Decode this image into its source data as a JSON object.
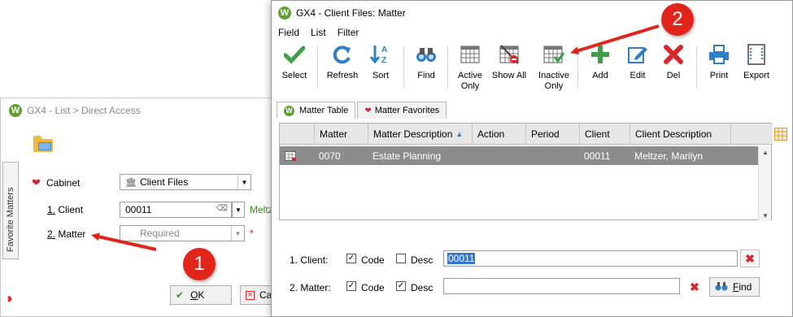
{
  "back_window": {
    "title": "GX4 - List > Direct Access",
    "vertical_tab": "Favorite Matters",
    "cabinet_label": "Cabinet",
    "cabinet_value": "Client Files",
    "client_label_num": "1.",
    "client_label": " Client",
    "client_value": "00011",
    "client_name_partial": "Meltz",
    "matter_label_num": "2.",
    "matter_label": " Matter",
    "matter_placeholder": "Required",
    "required_mark": "*",
    "ok_label_u": "O",
    "ok_label_rest": "K",
    "cancel_partial": "Ca"
  },
  "front_window": {
    "title": "GX4 - Client Files: Matter",
    "menu": [
      "Field",
      "List",
      "Filter"
    ],
    "toolbar": {
      "select": "Select",
      "refresh": "Refresh",
      "sort": "Sort",
      "find": "Find",
      "active_only": [
        "Active",
        "Only"
      ],
      "show_all": "Show All",
      "inactive_only": [
        "Inactive",
        "Only"
      ],
      "add": "Add",
      "edit": "Edit",
      "del": "Del",
      "print": "Print",
      "export": "Export"
    },
    "tabs": [
      {
        "label": "Matter Table",
        "active": true
      },
      {
        "label": "Matter Favorites",
        "active": false
      }
    ],
    "grid": {
      "columns": [
        "Matter",
        "Matter Description",
        "Action",
        "Period",
        "Client",
        "Client Description"
      ],
      "sorted_column": "Matter Description",
      "rows": [
        {
          "matter": "0070",
          "description": "Estate Planning",
          "action": "",
          "period": "",
          "client": "00011",
          "client_description": "Meltzer, Marilyn"
        }
      ]
    },
    "filters": {
      "client_label": "1. Client:",
      "matter_label": "2. Matter:",
      "code_label": "Code",
      "desc_label": "Desc",
      "client_code_checked": true,
      "client_desc_checked": false,
      "matter_code_checked": true,
      "matter_desc_checked": true,
      "client_value": "00011",
      "matter_value": "",
      "find_label_u": "F",
      "find_label_rest": "ind"
    }
  },
  "annotations": {
    "badge1": "1",
    "badge2": "2",
    "arrow_color": "#e1251b"
  },
  "colors": {
    "accent_green": "#5da02e",
    "delete_red": "#d8262b",
    "selected_row": "#8c8c8c",
    "selection_blue": "#3377d6"
  }
}
